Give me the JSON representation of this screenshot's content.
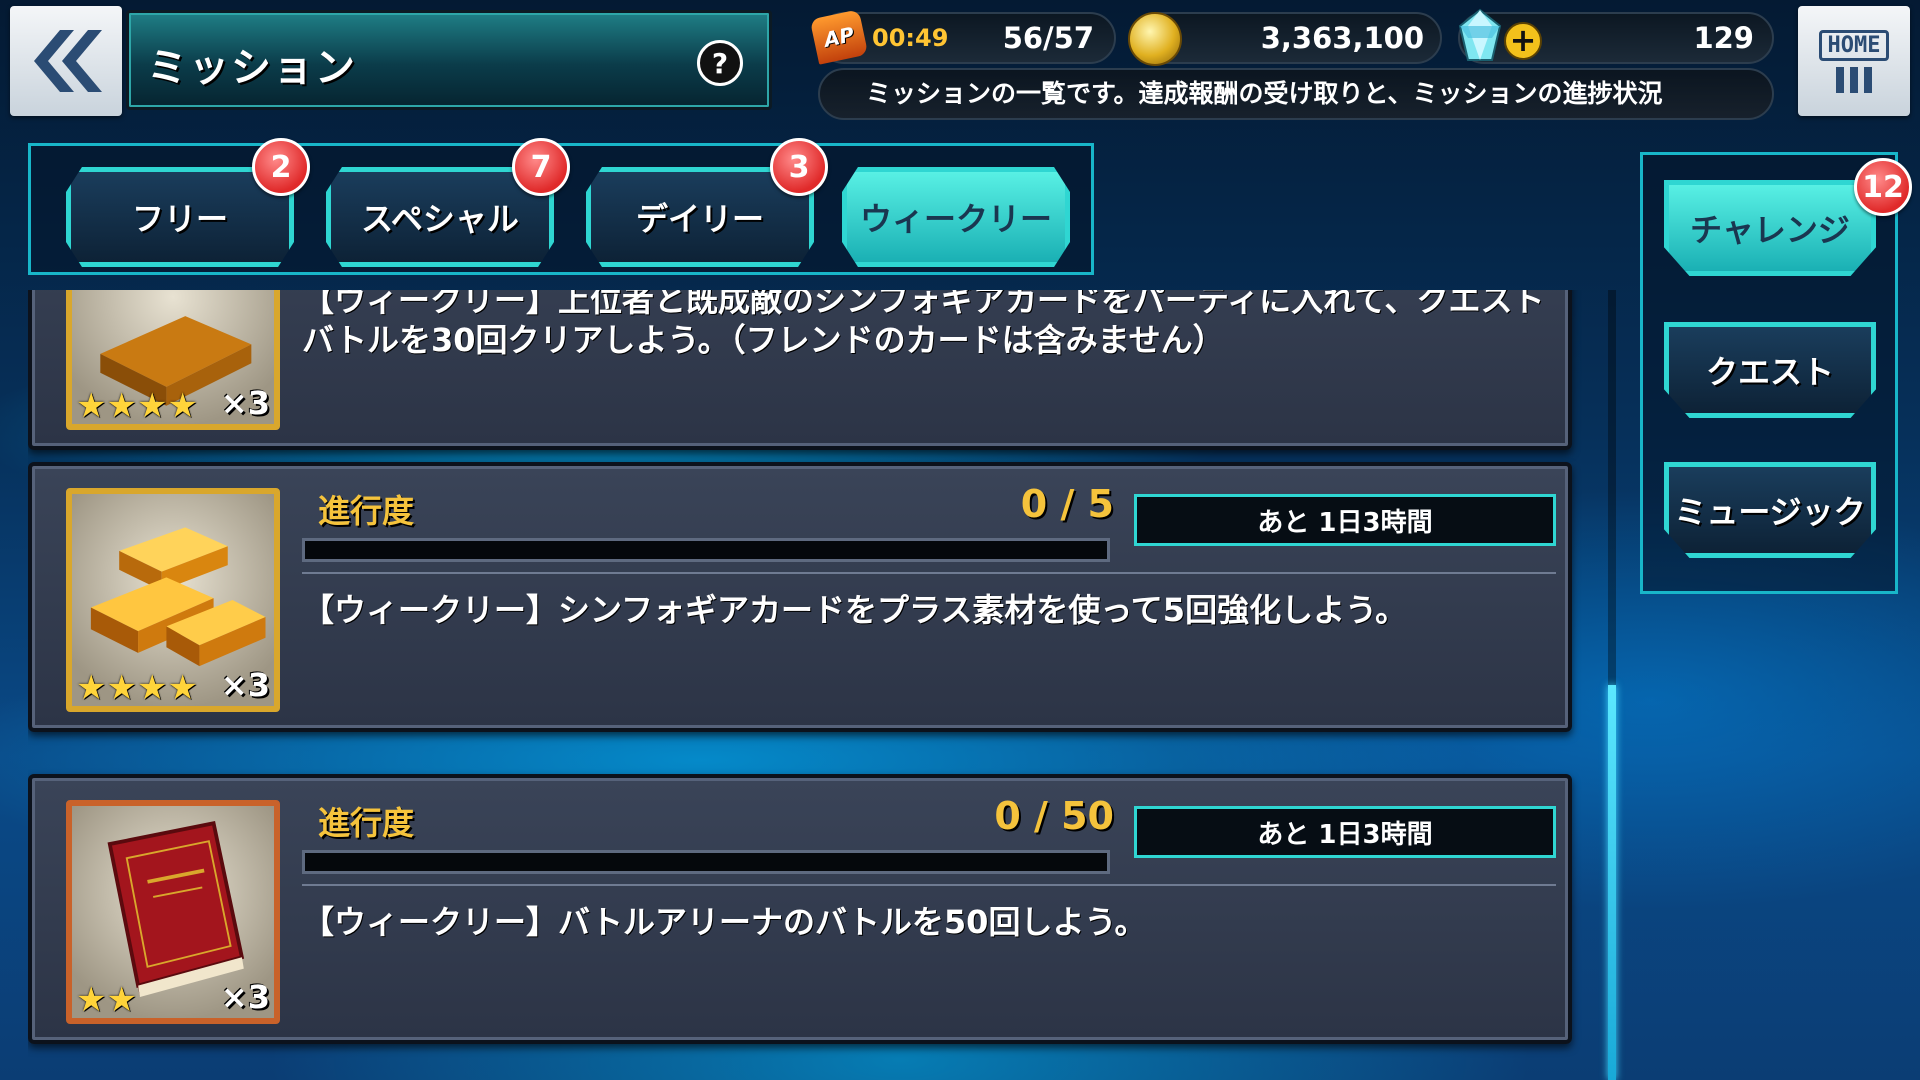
{
  "header": {
    "title": "ミッション",
    "help_icon": "question-icon",
    "help_glyph": "?",
    "back_icon": "double-chevron-left-icon",
    "home_label": "HOME"
  },
  "status": {
    "ap_icon_label": "AP",
    "ap_timer": "00:49",
    "ap_value": "56/57",
    "coins": "3,363,100",
    "gems": "129",
    "plus_glyph": "+"
  },
  "info_text": "ミッションの一覧です。達成報酬の受け取りと、ミッションの進捗状況",
  "tabs": [
    {
      "label": "フリー",
      "badge": "2",
      "active": false
    },
    {
      "label": "スペシャル",
      "badge": "7",
      "active": false
    },
    {
      "label": "デイリー",
      "badge": "3",
      "active": false
    },
    {
      "label": "ウィークリー",
      "badge": "",
      "active": true
    }
  ],
  "side_tabs": [
    {
      "label": "チャレンジ",
      "badge": "12",
      "active": true
    },
    {
      "label": "クエスト",
      "active": false
    },
    {
      "label": "ミュージック",
      "active": false
    }
  ],
  "missions": [
    {
      "reward_icon": "gold-bars-icon",
      "stars": "★★★★",
      "quantity": "×3",
      "description": "【ウィークリー】上位者と既成敵のシンフォギアカードをパーティに入れて、クエストバトルを30回クリアしよう。（フレンドのカードは含みません）"
    },
    {
      "reward_icon": "gold-bars-icon",
      "stars": "★★★★",
      "quantity": "×3",
      "progress_label": "進行度",
      "progress": "0 / 5",
      "progress_fraction": 0,
      "time_remaining": "あと 1日3時間",
      "description": "【ウィークリー】シンフォギアカードをプラス素材を使って5回強化しよう。"
    },
    {
      "reward_icon": "memories-book-icon",
      "stars": "★★",
      "quantity": "×3",
      "progress_label": "進行度",
      "progress": "0 / 50",
      "progress_fraction": 0,
      "time_remaining": "あと 1日3時間",
      "description": "【ウィークリー】バトルアリーナのバトルを50回しよう。"
    }
  ],
  "colors": {
    "accent": "#2fd6d2",
    "progress_text": "#f5c33c",
    "badge": "#e02a2a"
  }
}
